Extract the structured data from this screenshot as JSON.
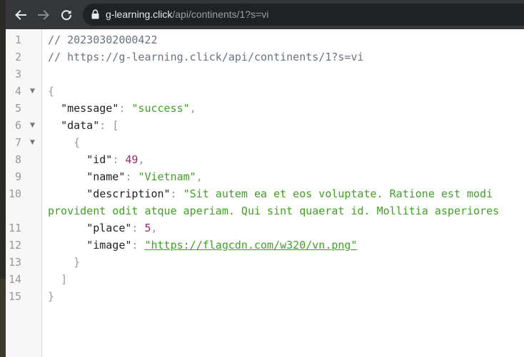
{
  "browser": {
    "url_host": "g-learning.click",
    "url_path": "/api/continents/1?s=vi"
  },
  "json_viewer": {
    "line_numbers": [
      "1",
      "2",
      "3",
      "4",
      "5",
      "6",
      "7",
      "8",
      "9",
      "10",
      "11",
      "12",
      "13",
      "14",
      "15"
    ],
    "comment_timestamp": "// 20230302000422",
    "comment_url": "// https://g-learning.click/api/continents/1?s=vi",
    "open_brace": "{",
    "close_brace": "}",
    "open_bracket": "[",
    "close_bracket": "]",
    "colon": ": ",
    "comma": ",",
    "keys": {
      "message": "\"message\"",
      "data": "\"data\"",
      "id": "\"id\"",
      "name": "\"name\"",
      "description": "\"description\"",
      "place": "\"place\"",
      "image": "\"image\""
    },
    "values": {
      "message": "\"success\"",
      "id": "49",
      "name": "\"Vietnam\"",
      "description_part1": "\"Sit autem ea et eos voluptate. Ratione est modi",
      "description_part2": "provident odit atque aperiam. Qui sint quaerat id. Mollitia asperiores",
      "place": "5",
      "image": "\"https://flagcdn.com/w320/vn.png\""
    }
  }
}
